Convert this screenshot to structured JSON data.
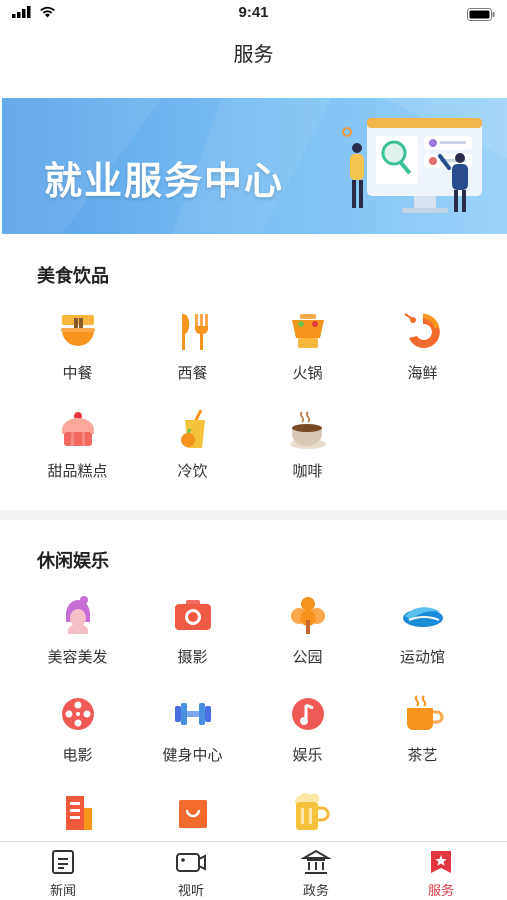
{
  "status": {
    "time": "9:41"
  },
  "header": {
    "title": "服务"
  },
  "banner": {
    "text": "就业服务中心"
  },
  "sections": [
    {
      "title": "美食饮品",
      "items": [
        {
          "label": "中餐",
          "icon": "noodle-bowl-icon"
        },
        {
          "label": "西餐",
          "icon": "fork-knife-icon"
        },
        {
          "label": "火锅",
          "icon": "hotpot-icon"
        },
        {
          "label": "海鲜",
          "icon": "shrimp-icon"
        },
        {
          "label": "甜品糕点",
          "icon": "cake-icon"
        },
        {
          "label": "冷饮",
          "icon": "cold-drink-icon"
        },
        {
          "label": "咖啡",
          "icon": "coffee-icon"
        }
      ]
    },
    {
      "title": "休闲娱乐",
      "items": [
        {
          "label": "美容美发",
          "icon": "hair-beauty-icon"
        },
        {
          "label": "摄影",
          "icon": "camera-icon"
        },
        {
          "label": "公园",
          "icon": "tree-icon"
        },
        {
          "label": "运动馆",
          "icon": "wave-stadium-icon"
        },
        {
          "label": "电影",
          "icon": "film-reel-icon"
        },
        {
          "label": "健身中心",
          "icon": "dumbbell-icon"
        },
        {
          "label": "娱乐",
          "icon": "music-note-icon"
        },
        {
          "label": "茶艺",
          "icon": "tea-cup-icon"
        },
        {
          "label": "",
          "icon": "building-icon"
        },
        {
          "label": "",
          "icon": "shopping-bag-icon"
        },
        {
          "label": "",
          "icon": "beer-icon"
        }
      ]
    }
  ],
  "tabbar": {
    "items": [
      {
        "label": "新闻",
        "icon": "news-icon"
      },
      {
        "label": "视听",
        "icon": "video-icon"
      },
      {
        "label": "政务",
        "icon": "government-icon"
      },
      {
        "label": "服务",
        "icon": "service-icon"
      }
    ],
    "active_index": 3,
    "active_color": "#e0383e"
  },
  "colors": {
    "orange": "#f7941d",
    "red": "#e0383e",
    "blue": "#4a8fe0"
  }
}
